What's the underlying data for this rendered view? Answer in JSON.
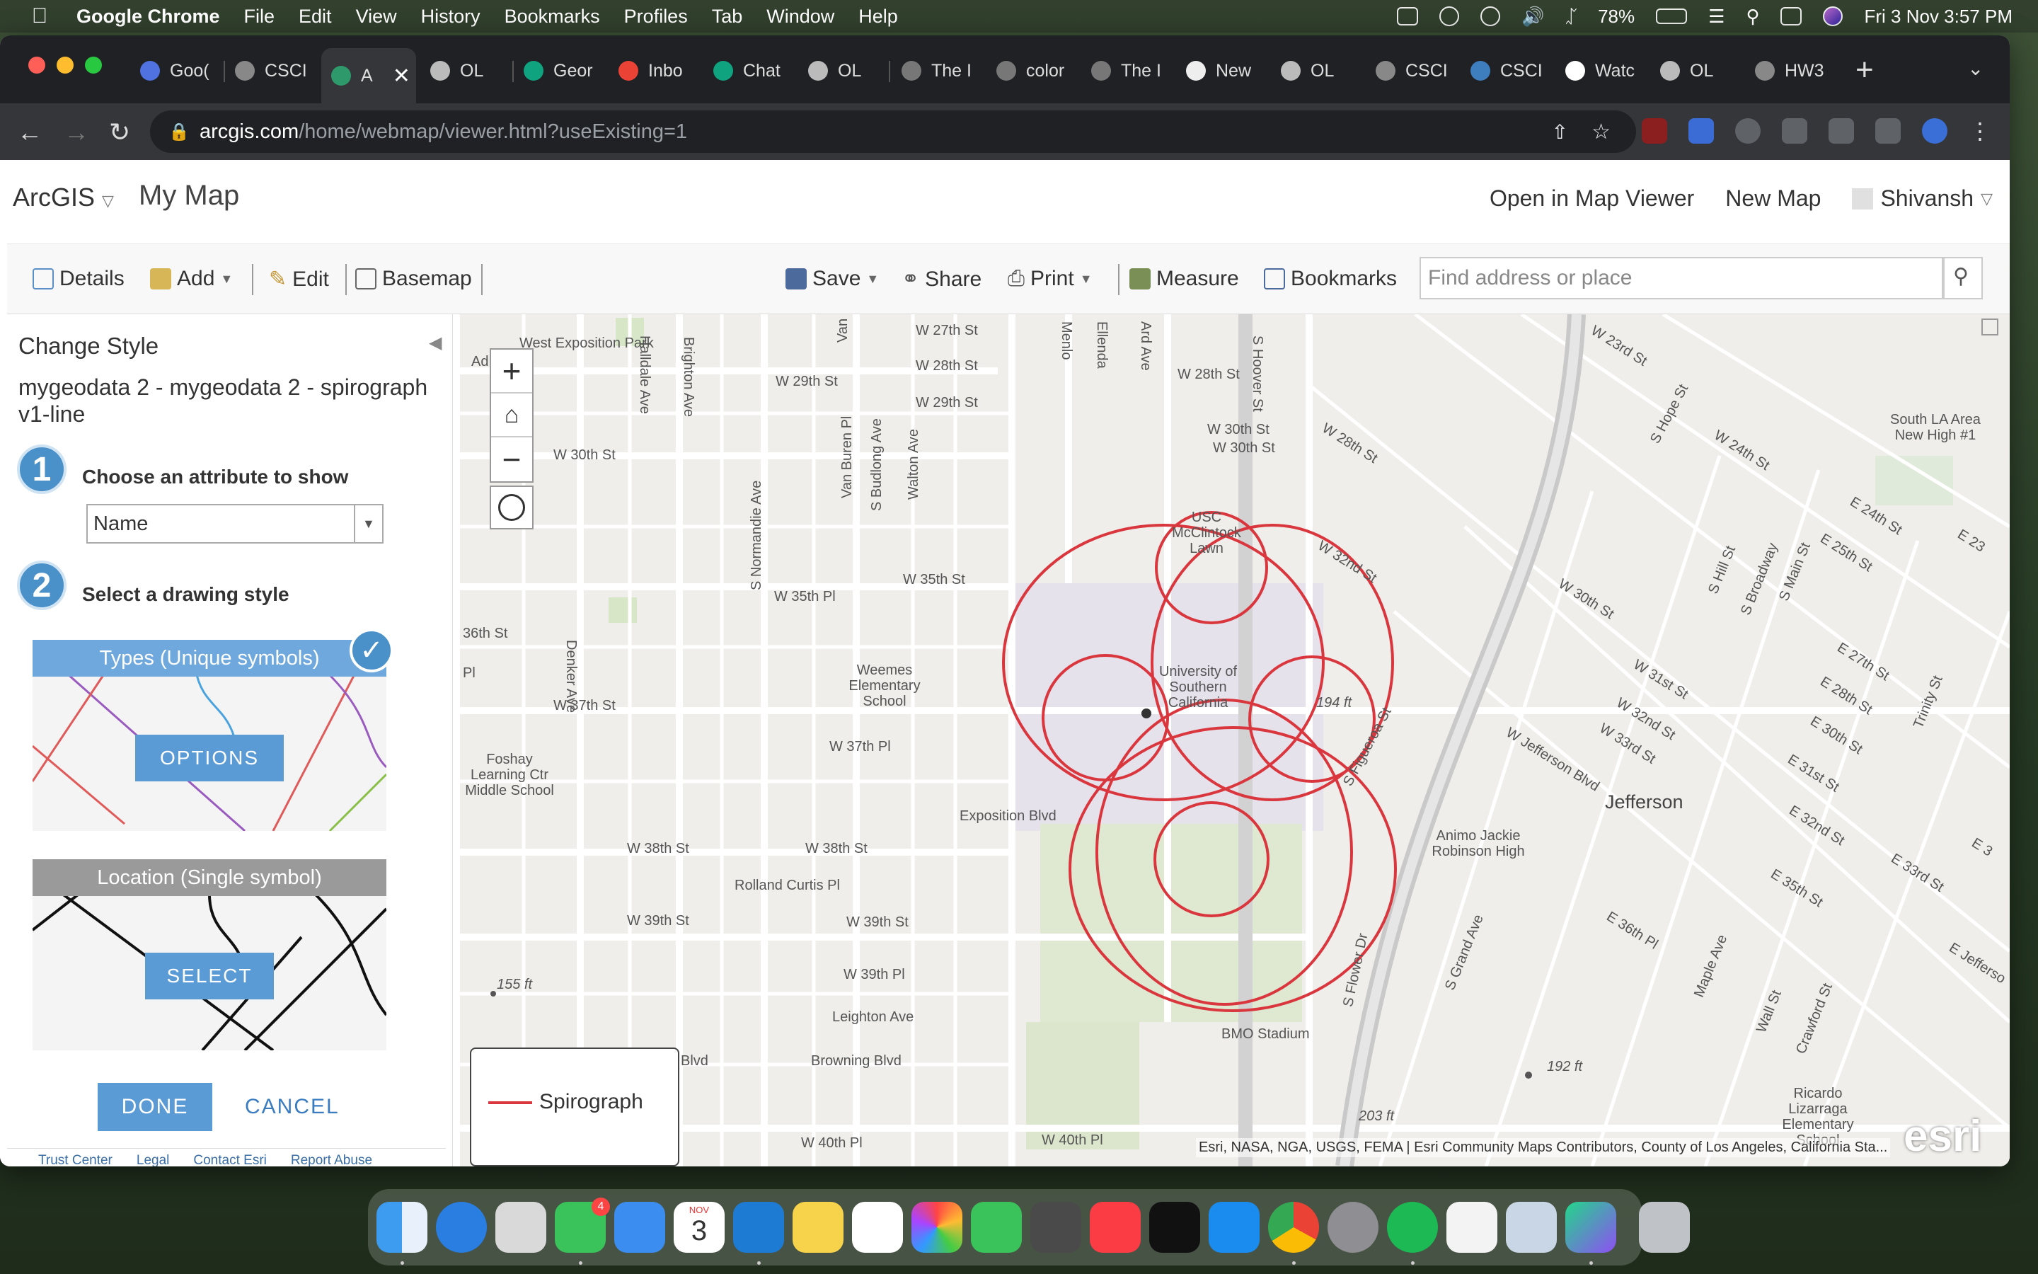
{
  "menubar": {
    "app": "Google Chrome",
    "items": [
      "File",
      "Edit",
      "View",
      "History",
      "Bookmarks",
      "Profiles",
      "Tab",
      "Window",
      "Help"
    ],
    "battery": "78%",
    "datetime": "Fri 3 Nov  3:57 PM"
  },
  "tabs": [
    "Goo(",
    "CSCI",
    "A",
    "OL",
    "Geor",
    "Inbo",
    "Chat",
    "OL",
    "The I",
    "color",
    "The I",
    "New",
    "OL",
    "CSCI",
    "CSCI",
    "Watc",
    "OL",
    "HW3"
  ],
  "address": {
    "host": "arcgis.com",
    "path": "/home/webmap/viewer.html?useExisting=1"
  },
  "header": {
    "logo": "ArcGIS",
    "map_title": "My Map",
    "open_viewer": "Open in Map Viewer",
    "new_map": "New Map",
    "user": "Shivansh"
  },
  "toolbar": {
    "details": "Details",
    "add": "Add",
    "edit": "Edit",
    "basemap": "Basemap",
    "save": "Save",
    "share": "Share",
    "print": "Print",
    "measure": "Measure",
    "bookmarks": "Bookmarks",
    "search_placeholder": "Find address or place"
  },
  "panel": {
    "title": "Change Style",
    "layer": "mygeodata 2 - mygeodata 2 - spirograph v1-line",
    "step1_num": "1",
    "step1": "Choose an attribute to show",
    "attribute": "Name",
    "step2_num": "2",
    "step2": "Select a drawing style",
    "types_title": "Types (Unique symbols)",
    "options_btn": "OPTIONS",
    "location_title": "Location (Single symbol)",
    "select_btn": "SELECT",
    "done": "DONE",
    "cancel": "CANCEL"
  },
  "footer": [
    "Trust Center",
    "Legal",
    "Contact Esri",
    "Report Abuse"
  ],
  "map": {
    "legend_label": "Spirograph",
    "attribution": "Esri, NASA, NGA, USGS, FEMA | Esri Community Maps Contributors, County of Los Angeles, California Sta...",
    "esri": "esri",
    "labels": [
      "West Exposition Park",
      "W 27th St",
      "W 28th St",
      "W 29th St",
      "W 30th St",
      "W 28th St",
      "W 29th St",
      "W 30th St",
      "W 28th St",
      "W 32nd St",
      "USC McClintock Lawn",
      "W 35th St",
      "W 35th Pl",
      "36th St",
      "Weemes Elementary School",
      "University of Southern California",
      "194 ft",
      "W 37th St",
      "W 37th Pl",
      "Foshay Learning Ctr Middle School",
      "Exposition Blvd",
      "W 38th St",
      "W 38th St",
      "Rolland Curtis Pl",
      "W 39th St",
      "W 39th St",
      "W 39th Pl",
      "Leighton Ave",
      "155 ft",
      "Browning Blvd",
      "Blvd",
      "BMO Stadium",
      "203 ft",
      "192 ft",
      "W 40th Pl",
      "W 40th Pl",
      "Jefferson",
      "Animo Jackie Robinson High",
      "South LA Area New High #1",
      "Ricardo Lizarraga Elementary School",
      "S Figueroa St",
      "S Flower Dr",
      "S Grand Ave",
      "S Hope St",
      "S Hill St",
      "S Broadway",
      "S Main St",
      "E 24th St",
      "E 25th St",
      "E 27th St",
      "E 28th St",
      "E 30th St",
      "E 31st St",
      "E 32nd St",
      "E 33rd St",
      "E 35th St",
      "E 36th Pl",
      "W 23rd St",
      "W 24th St",
      "W 30th St",
      "W 31st St",
      "W 32nd St",
      "W 33rd St",
      "W Jefferson Blvd",
      "Trinity St",
      "Maple Ave",
      "Wall St",
      "Crawford St",
      "Denker Ave",
      "Halldale Ave",
      "Brighton Ave",
      "S Normandie Ave",
      "Van Buren Pl",
      "S Budlong Ave",
      "Walton Ave",
      "S Hoover St",
      "Menlo",
      "Ellenda",
      "Ard Ave",
      "W 30th St",
      "Pl",
      "Ad",
      "E 23",
      "E 3",
      "E Jefferso",
      "Van"
    ]
  },
  "dock": [
    "Finder",
    "Safari",
    "Launchpad",
    "Messages",
    "Mail",
    "Calendar",
    "VS Code",
    "Notes",
    "Reminders",
    "Photos",
    "FaceTime",
    "Sublime",
    "Music",
    "TV",
    "App Store",
    "Chrome",
    "Settings",
    "Spotify",
    "TextEdit",
    "Preview",
    "DataGrip",
    "Trash"
  ],
  "dock_calendar": {
    "month": "NOV",
    "day": "3"
  },
  "colors": {
    "spirograph": "#d9363e",
    "accent": "#4a90c9",
    "button": "#5b9bd5"
  }
}
